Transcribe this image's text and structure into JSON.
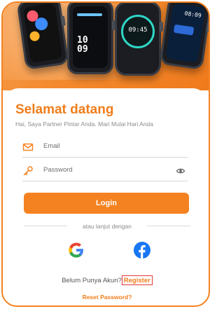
{
  "theme": {
    "accent": "#f58220",
    "register_border": "#e03a3a"
  },
  "hero": {
    "watches": [
      {
        "time_text": "",
        "kind": "colorful"
      },
      {
        "time_text": "10\n09",
        "kind": "digital"
      },
      {
        "time_text": "09:45",
        "kind": "analog-ring"
      },
      {
        "time_text": "08:09",
        "kind": "minimal"
      }
    ]
  },
  "header": {
    "title": "Selamat datang",
    "subtitle": "Hai, Saya Partner Pintar Anda. Mari Mulai Hari Anda"
  },
  "form": {
    "email_placeholder": "Email",
    "password_placeholder": "Password",
    "login_label": "Login"
  },
  "alt_login": {
    "divider_text": "atau lanjut dengan",
    "providers": [
      "google-icon",
      "facebook-icon"
    ]
  },
  "footer": {
    "signup_prompt": "Belum Punya Akun?",
    "register_label": "Register",
    "reset_label": "Reset Password?"
  }
}
